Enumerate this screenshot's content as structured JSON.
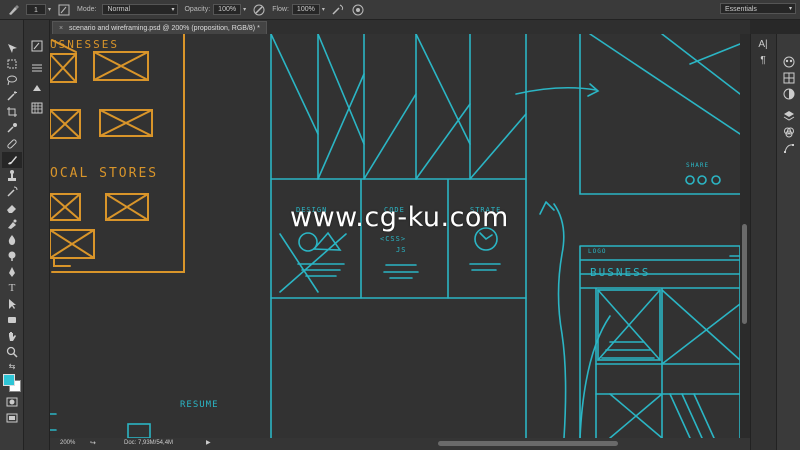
{
  "options_bar": {
    "brush_size": "1",
    "mode_label": "Mode:",
    "mode_value": "Normal",
    "opacity_label": "Opacity:",
    "opacity_value": "100%",
    "flow_label": "Flow:",
    "flow_value": "100%",
    "workspace": "Essentials"
  },
  "document_tab": {
    "title": "scenario and wireframing.psd @ 200% (proposition, RGB/8) *",
    "close": "×"
  },
  "status_bar": {
    "zoom": "200%",
    "doc_info": "Doc: 7,93M/54,4M"
  },
  "sketch": {
    "heading_businesses": "USNESSES",
    "heading_local_stores": "OCAL STORES",
    "label_design": "DESIGN",
    "label_code": "CODE",
    "label_code_brackets": "<CSS>",
    "label_js": "JS",
    "label_strategy": "STRATE",
    "label_share": "SHARE",
    "label_logo": "LOGO",
    "label_businesses_right": "BUSNESS",
    "label_resume": "RESUME"
  },
  "watermark": "www.cg-ku.com",
  "colors": {
    "orange_sketch": "#d9952a",
    "teal_sketch": "#2bb5c4",
    "canvas_bg": "#323232",
    "ui_panel": "#3a3a3a",
    "foreground_swatch": "#2ec5d6",
    "background_swatch": "#ffffff"
  },
  "icons": [
    "brush-tool-icon",
    "airbrush-icon",
    "pressure-opacity-icon",
    "pressure-size-icon",
    "move-tool-icon",
    "marquee-tool-icon",
    "lasso-tool-icon",
    "magic-wand-icon",
    "crop-tool-icon",
    "eyedropper-icon",
    "healing-brush-icon",
    "brush-tool-icon",
    "clone-stamp-icon",
    "history-brush-icon",
    "eraser-icon",
    "gradient-tool-icon",
    "blur-tool-icon",
    "dodge-tool-icon",
    "pen-tool-icon",
    "type-tool-icon",
    "path-selection-icon",
    "shape-tool-icon",
    "hand-tool-icon",
    "zoom-tool-icon",
    "quick-mask-icon",
    "character-panel-icon",
    "paragraph-panel-icon",
    "color-panel-icon",
    "adjustments-panel-icon",
    "layers-panel-icon",
    "channels-panel-icon",
    "paths-panel-icon"
  ]
}
